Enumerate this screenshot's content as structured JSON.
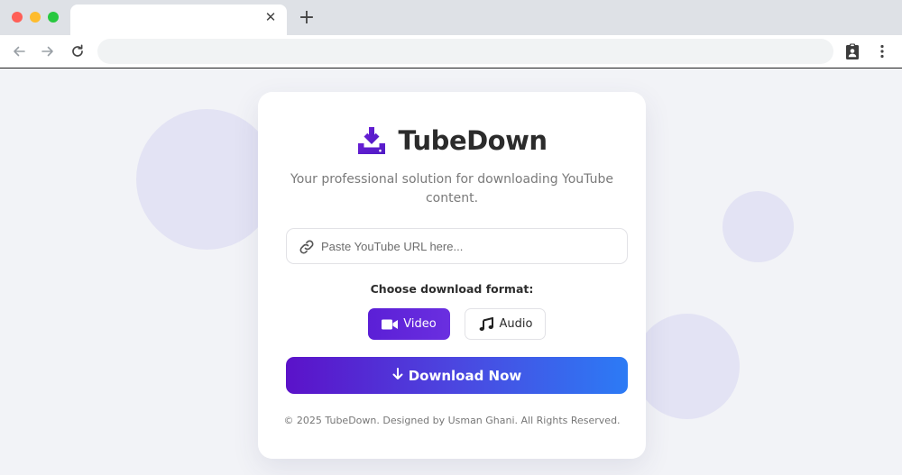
{
  "browser": {
    "tab_title": "",
    "tab_close_glyph": "✕",
    "new_tab_glyph": "+",
    "address_value": "",
    "icons": [
      "back-arrow-icon",
      "forward-arrow-icon",
      "reload-icon",
      "clipboard-account-icon",
      "more-vert-icon"
    ]
  },
  "app": {
    "name": "TubeDown",
    "logo_icon": "download-icon",
    "tagline": "Your professional solution for downloading YouTube content.",
    "url_input": {
      "placeholder": "Paste YouTube URL here...",
      "value": "",
      "icon": "link-icon"
    },
    "format_label": "Choose download format:",
    "formats": [
      {
        "label": "Video",
        "icon": "video-camera-icon",
        "selected": true
      },
      {
        "label": "Audio",
        "icon": "music-note-icon",
        "selected": false
      }
    ],
    "download_label": "Download Now",
    "download_icon": "arrow-down-icon",
    "footer": "© 2025 TubeDown. Designed by Usman Ghani. All Rights Reserved."
  },
  "colors": {
    "accent_purple": "#5b1fd6",
    "gradient_end_blue": "#2c7bf5",
    "page_background": "#f2f3f7"
  }
}
